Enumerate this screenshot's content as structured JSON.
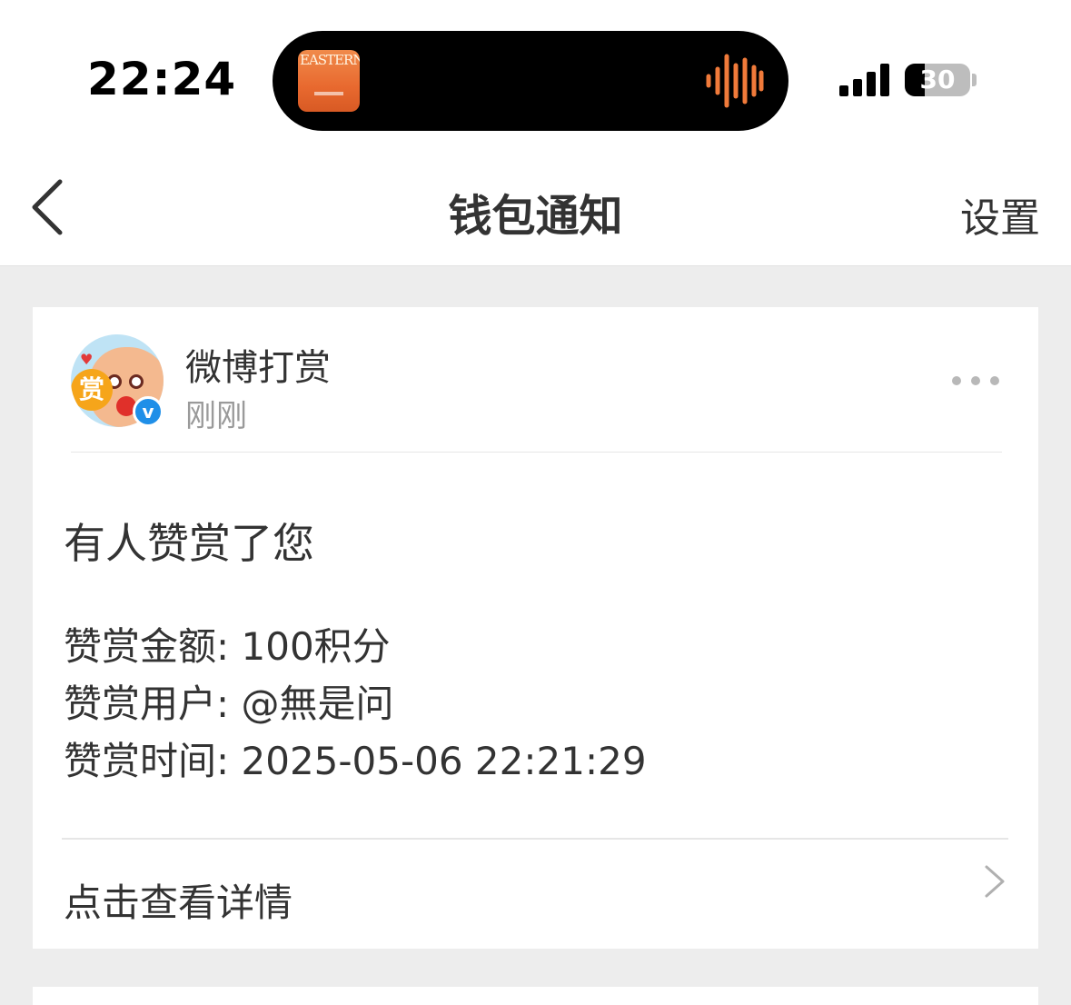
{
  "status_bar": {
    "time": "22:24",
    "battery": "30",
    "battery_level": 0.3,
    "island_thumb_text": "EASTERN"
  },
  "nav": {
    "title": "钱包通知",
    "settings": "设置"
  },
  "notification": {
    "avatar_badge": "赏",
    "sender": "微博打赏",
    "time": "刚刚",
    "title": "有人赞赏了您",
    "details": [
      "赞赏金额: 100积分",
      "赞赏用户: @無是问",
      "赞赏时间: 2025-05-06 22:21:29"
    ],
    "action_label": "点击查看详情"
  },
  "colors": {
    "background": "#ededed",
    "card": "#ffffff",
    "wave_accent": "#f07a3a",
    "verified_badge": "#1f8fe8"
  }
}
